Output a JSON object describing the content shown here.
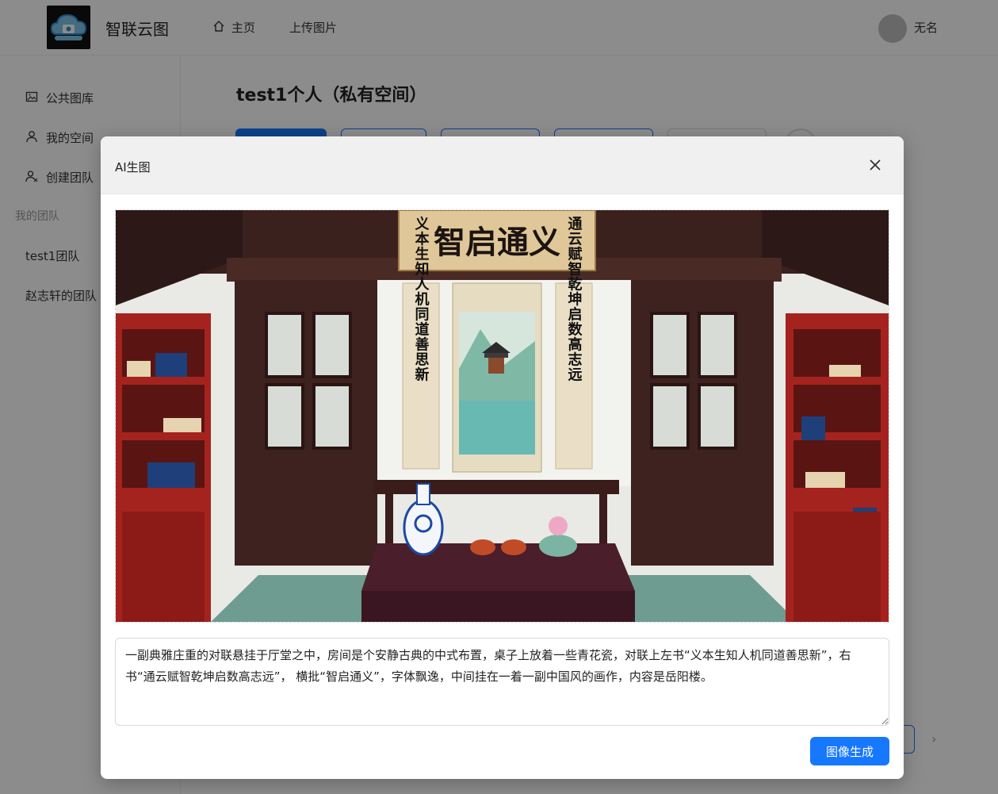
{
  "header": {
    "brand": "智联云图",
    "nav": [
      {
        "label": "主页",
        "icon": "home-icon"
      },
      {
        "label": "上传图片"
      }
    ],
    "user": {
      "name": "无名"
    }
  },
  "sidebar": {
    "items": [
      {
        "label": "公共图库",
        "icon": "image-icon"
      },
      {
        "label": "我的空间",
        "icon": "user-icon"
      },
      {
        "label": "创建团队",
        "icon": "team-add-icon"
      }
    ],
    "group_title": "我的团队",
    "teams": [
      "test1团队",
      "赵志轩的团队"
    ]
  },
  "main": {
    "title": "test1个人（私有空间）"
  },
  "modal": {
    "title": "AI生图",
    "image": {
      "plaque": "智启通义",
      "left_scroll": "义本生知人机同道善思新",
      "right_scroll": "通云赋智乾坤启数高志远"
    },
    "prompt": "一副典雅庄重的对联悬挂于厅堂之中，房间是个安静古典的中式布置，桌子上放着一些青花瓷，对联上左书“义本生知人机同道善思新”，右书“通云赋智乾坤启数高志远”， 横批“智启通义”，字体飘逸，中间挂在一着一副中国风的画作，内容是岳阳楼。",
    "generate_label": "图像生成"
  },
  "colors": {
    "primary": "#1677ff",
    "mask": "rgba(0,0,0,0.45)",
    "wood_dark": "#3b1f1c",
    "lacquer_red": "#a5231f"
  }
}
